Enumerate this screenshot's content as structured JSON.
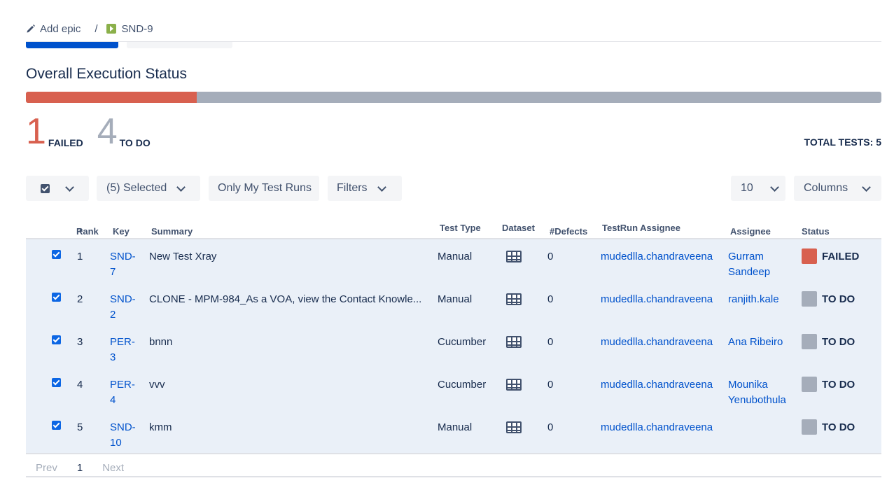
{
  "breadcrumb": {
    "add_epic": "Add epic",
    "separator": "/",
    "issue_key": "SND-9"
  },
  "section_title": "Overall Execution Status",
  "progress": {
    "failed_fraction": 0.2,
    "todo_fraction": 0.8,
    "failed_color": "#d8604f",
    "todo_color": "#a5adba"
  },
  "counts": [
    {
      "num": "1",
      "label": "FAILED",
      "color": "#d8604f"
    },
    {
      "num": "4",
      "label": "TO DO",
      "color": "#a5adba"
    }
  ],
  "total_tests": "TOTAL TESTS: 5",
  "toolbar": {
    "selected": "(5) Selected",
    "only_my": "Only My Test Runs",
    "filters": "Filters",
    "page_size": "10",
    "columns": "Columns"
  },
  "columns": {
    "rank": "Rank",
    "key": "Key",
    "summary": "Summary",
    "test_type": "Test Type",
    "dataset": "Dataset",
    "defects": "#Defects",
    "testrun_assignee": "TestRun Assignee",
    "assignee": "Assignee",
    "status": "Status"
  },
  "rows": [
    {
      "rank": "1",
      "key1": "SND-",
      "key2": "7",
      "summary": "New Test Xray",
      "test_type": "Manual",
      "defects": "0",
      "testrun_assignee": "mudedlla.chandraveena",
      "assignee1": "Gurram",
      "assignee2": "Sandeep",
      "status": "FAILED",
      "status_color": "#d8604f"
    },
    {
      "rank": "2",
      "key1": "SND-",
      "key2": "2",
      "summary": "CLONE - MPM-984_As a VOA, view the Contact Knowle...",
      "test_type": "Manual",
      "defects": "0",
      "testrun_assignee": "mudedlla.chandraveena",
      "assignee1": "ranjith.kale",
      "assignee2": "",
      "status": "TO DO",
      "status_color": "#a5adba"
    },
    {
      "rank": "3",
      "key1": "PER-",
      "key2": "3",
      "summary": "bnnn",
      "test_type": "Cucumber",
      "defects": "0",
      "testrun_assignee": "mudedlla.chandraveena",
      "assignee1": "Ana Ribeiro",
      "assignee2": "",
      "status": "TO DO",
      "status_color": "#a5adba"
    },
    {
      "rank": "4",
      "key1": "PER-",
      "key2": "4",
      "summary": "vvv",
      "test_type": "Cucumber",
      "defects": "0",
      "testrun_assignee": "mudedlla.chandraveena",
      "assignee1": "Mounika",
      "assignee2": "Yenubothula",
      "status": "TO DO",
      "status_color": "#a5adba"
    },
    {
      "rank": "5",
      "key1": "SND-",
      "key2": "10",
      "summary": "kmm",
      "test_type": "Manual",
      "defects": "0",
      "testrun_assignee": "mudedlla.chandraveena",
      "assignee1": "",
      "assignee2": "",
      "status": "TO DO",
      "status_color": "#a5adba"
    }
  ],
  "pager": {
    "prev": "Prev",
    "current": "1",
    "next": "Next"
  }
}
